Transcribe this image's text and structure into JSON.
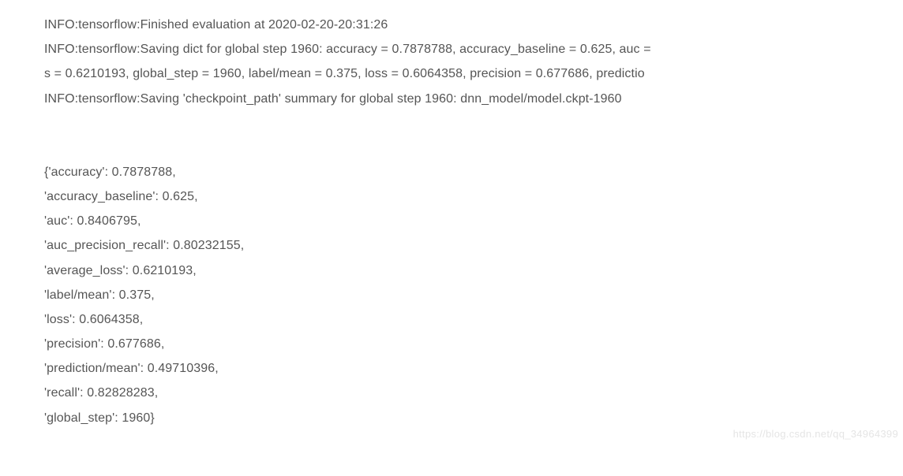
{
  "log": {
    "line1": "INFO:tensorflow:Finished evaluation at 2020-02-20-20:31:26",
    "line2": "INFO:tensorflow:Saving dict for global step 1960: accuracy = 0.7878788, accuracy_baseline = 0.625, auc =",
    "line3": "s = 0.6210193, global_step = 1960, label/mean = 0.375, loss = 0.6064358, precision = 0.677686, predictio",
    "line4": "INFO:tensorflow:Saving 'checkpoint_path' summary for global step 1960: dnn_model/model.ckpt-1960"
  },
  "dict": {
    "l1": "{'accuracy': 0.7878788,",
    "l2": " 'accuracy_baseline': 0.625,",
    "l3": " 'auc': 0.8406795,",
    "l4": " 'auc_precision_recall': 0.80232155,",
    "l5": " 'average_loss': 0.6210193,",
    "l6": " 'label/mean': 0.375,",
    "l7": " 'loss': 0.6064358,",
    "l8": " 'precision': 0.677686,",
    "l9": " 'prediction/mean': 0.49710396,",
    "l10": " 'recall': 0.82828283,",
    "l11": " 'global_step': 1960}"
  },
  "watermark": "https://blog.csdn.net/qq_34964399"
}
